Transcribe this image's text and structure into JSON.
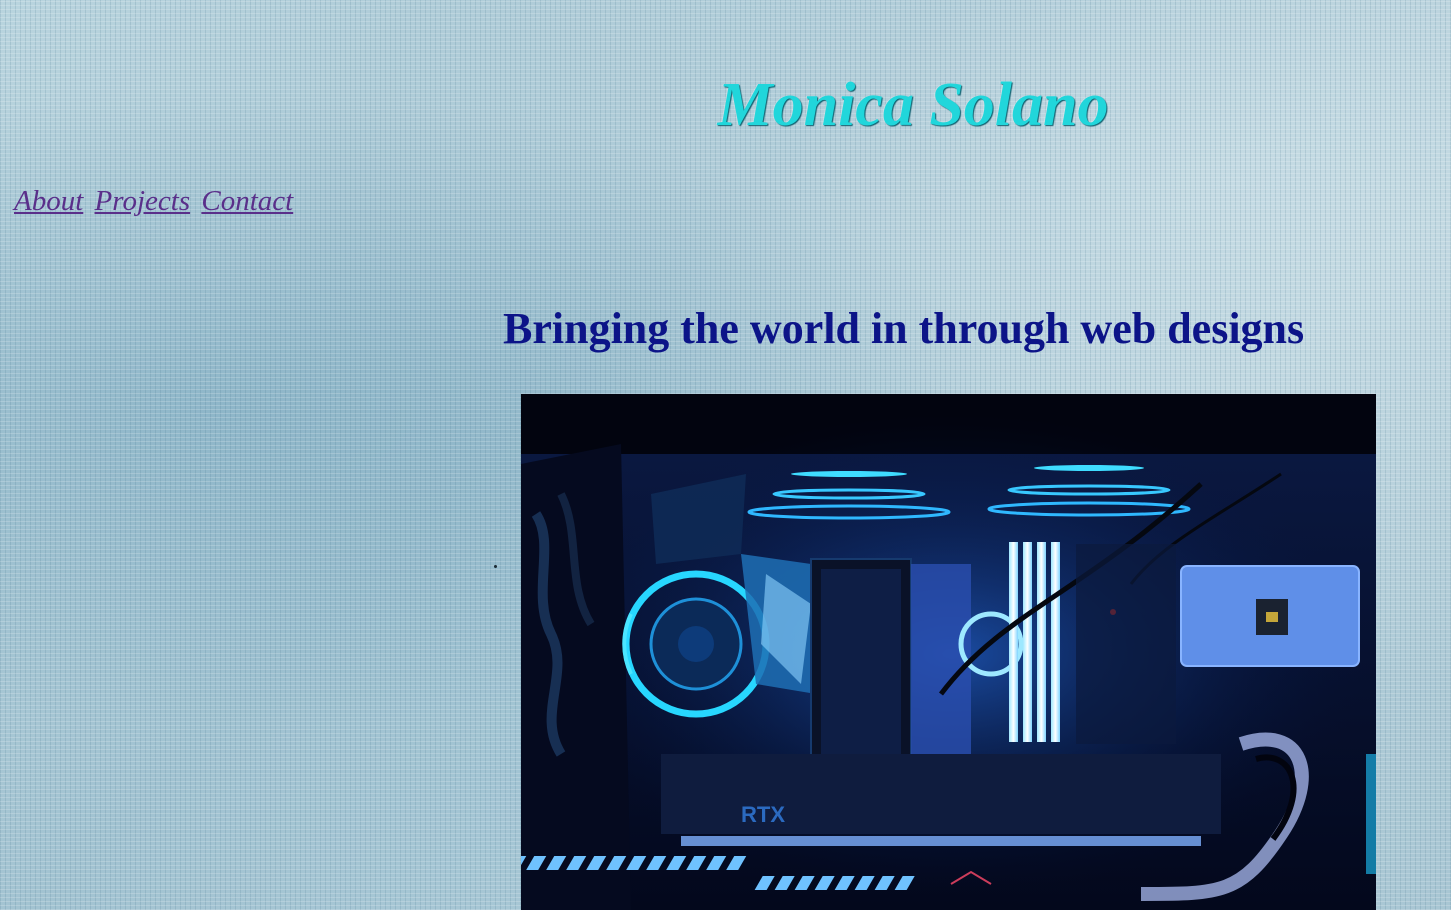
{
  "header": {
    "title": "Monica Solano"
  },
  "nav": {
    "items": [
      {
        "label": "About"
      },
      {
        "label": "Projects"
      },
      {
        "label": "Contact"
      }
    ]
  },
  "main": {
    "tagline": "Bringing the world in through web designs",
    "hero_image": {
      "alt": "PC build interior with blue and cyan RGB lighting"
    }
  },
  "colors": {
    "title": "#21d6db",
    "nav_link": "#5a2f8a",
    "tagline": "#0c1488",
    "background": "#a9c9d6"
  }
}
